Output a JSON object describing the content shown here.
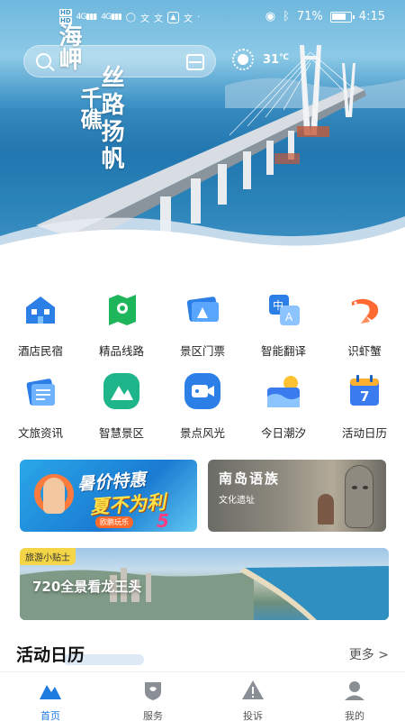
{
  "status_bar": {
    "left_indicators": [
      "HD",
      "HD"
    ],
    "signal_1": "4G",
    "signal_2": "4G",
    "app_glyphs": [
      "文",
      "文",
      "文"
    ],
    "battery_percent": "71%",
    "time": "4:15"
  },
  "hero": {
    "calligraphy_line_1": "海岬",
    "calligraphy_line_2": "千礁",
    "calligraphy_line_3": "丝路扬帆",
    "weather_temp": "31",
    "weather_unit": "℃"
  },
  "search": {
    "placeholder": ""
  },
  "grid": {
    "items": [
      {
        "label": "酒店民宿",
        "icon": "hotel-icon"
      },
      {
        "label": "精品线路",
        "icon": "route-map-icon"
      },
      {
        "label": "景区门票",
        "icon": "ticket-icon"
      },
      {
        "label": "智能翻译",
        "icon": "translate-icon"
      },
      {
        "label": "识虾蟹",
        "icon": "shrimp-icon"
      },
      {
        "label": "文旅资讯",
        "icon": "news-icon"
      },
      {
        "label": "智慧景区",
        "icon": "mountain-icon"
      },
      {
        "label": "景点风光",
        "icon": "video-camera-icon"
      },
      {
        "label": "今日潮汐",
        "icon": "tide-icon"
      },
      {
        "label": "活动日历",
        "icon": "calendar-icon"
      }
    ],
    "calendar_day": "7"
  },
  "banners": {
    "promo_line_1": "暑价特惠",
    "promo_line_2": "夏不为利",
    "promo_tag": "欧鹏玩乐",
    "promo_price": "5",
    "culture_title": "南岛语族",
    "culture_subtitle": "文化遗址",
    "tips_tag": "旅游小贴士",
    "tips_title": "720全景看龙王头"
  },
  "section": {
    "title": "活动日历",
    "more_label": "更多 >"
  },
  "tabbar": {
    "items": [
      {
        "label": "首页",
        "active": true
      },
      {
        "label": "服务",
        "active": false
      },
      {
        "label": "投诉",
        "active": false
      },
      {
        "label": "我的",
        "active": false
      }
    ]
  },
  "colors": {
    "accent": "#1e7be0",
    "icon_blue": "#2b7fe6",
    "icon_orange": "#ff6a33",
    "icon_green": "#1fb58a"
  }
}
